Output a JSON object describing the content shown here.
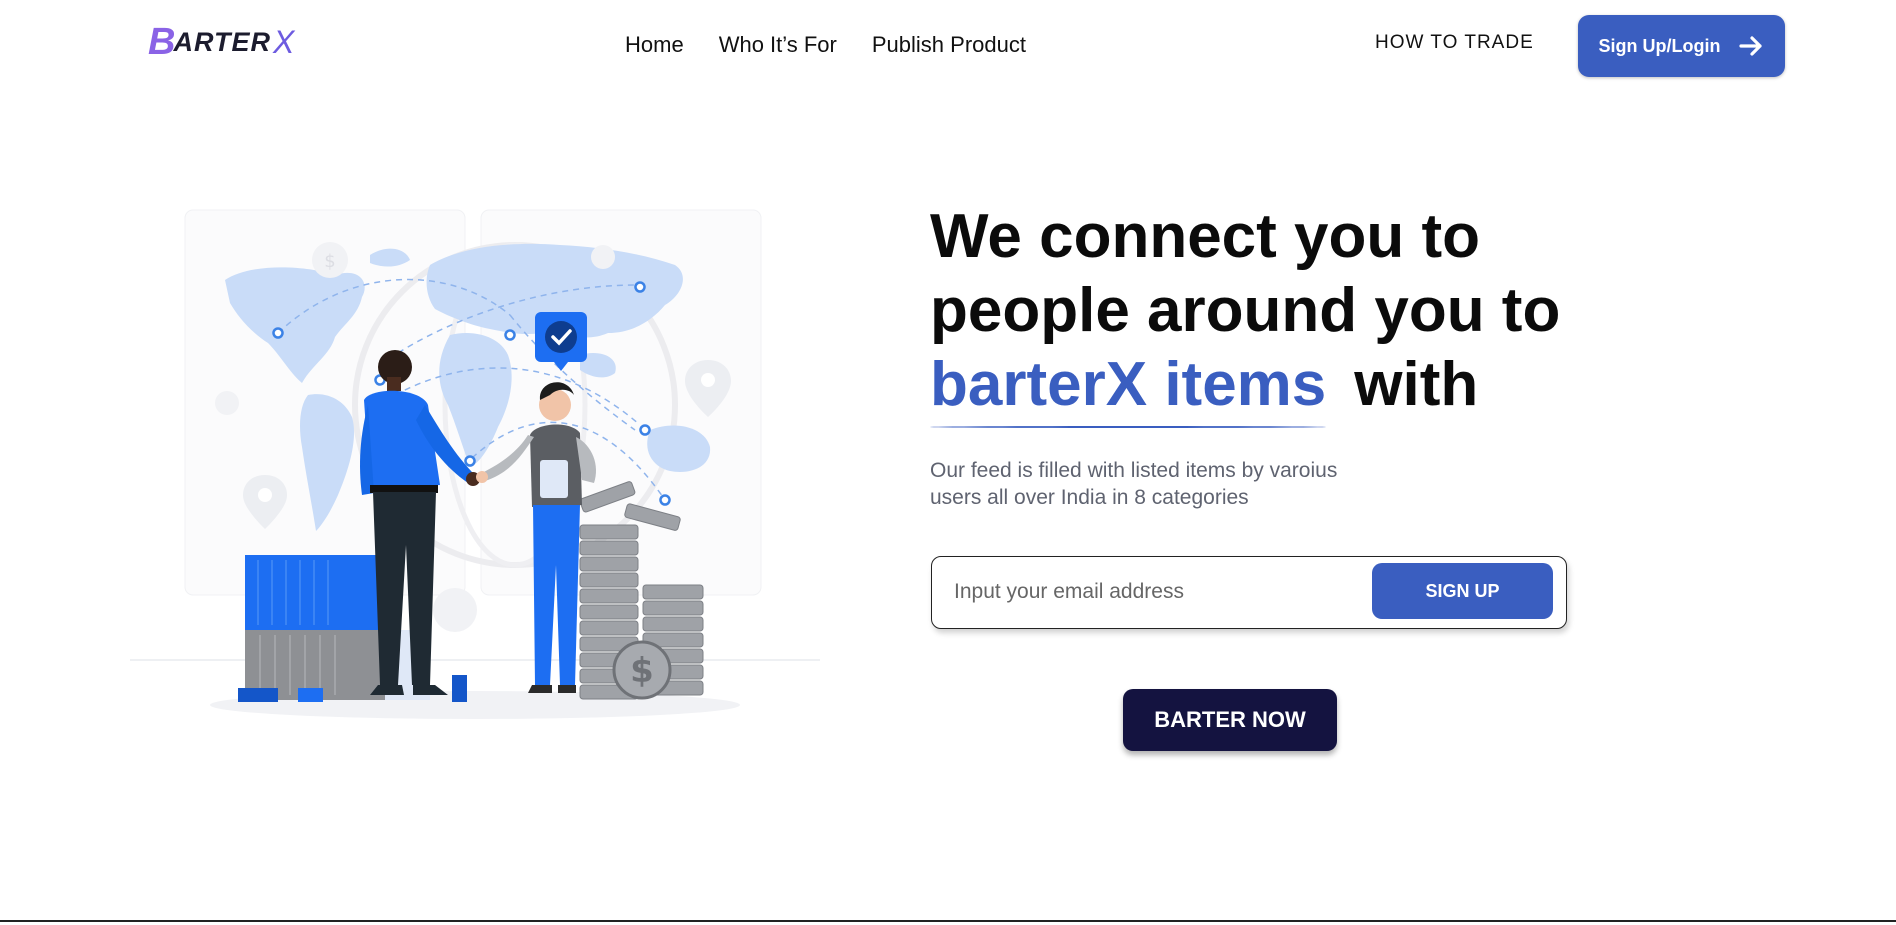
{
  "brand": {
    "logo_first": "B",
    "logo_mid": "ARTER",
    "logo_last": "X"
  },
  "nav": {
    "items": [
      "Home",
      "Who It’s For",
      "Publish Product"
    ]
  },
  "header": {
    "how_to_trade": "HOW TO TRADE",
    "login_label": "Sign Up/Login"
  },
  "hero": {
    "line1": "We connect you to",
    "line2": "people around you to",
    "highlight": "barterX items",
    "line3_end": "with",
    "subtitle": "Our feed is filled with listed items by varoius users all over India in 8 categories"
  },
  "signup": {
    "placeholder": "Input your email address",
    "button_label": "SIGN UP"
  },
  "cta": {
    "label": "BARTER NOW"
  },
  "colors": {
    "accent": "#3a5ec0",
    "cta_dark": "#141340",
    "logo_purple": "#8a63e6",
    "map_blue": "#c9dcf8"
  },
  "icons": [
    "arrow-right-icon",
    "check-badge-icon",
    "location-pin-icon",
    "dollar-coin-icon"
  ]
}
